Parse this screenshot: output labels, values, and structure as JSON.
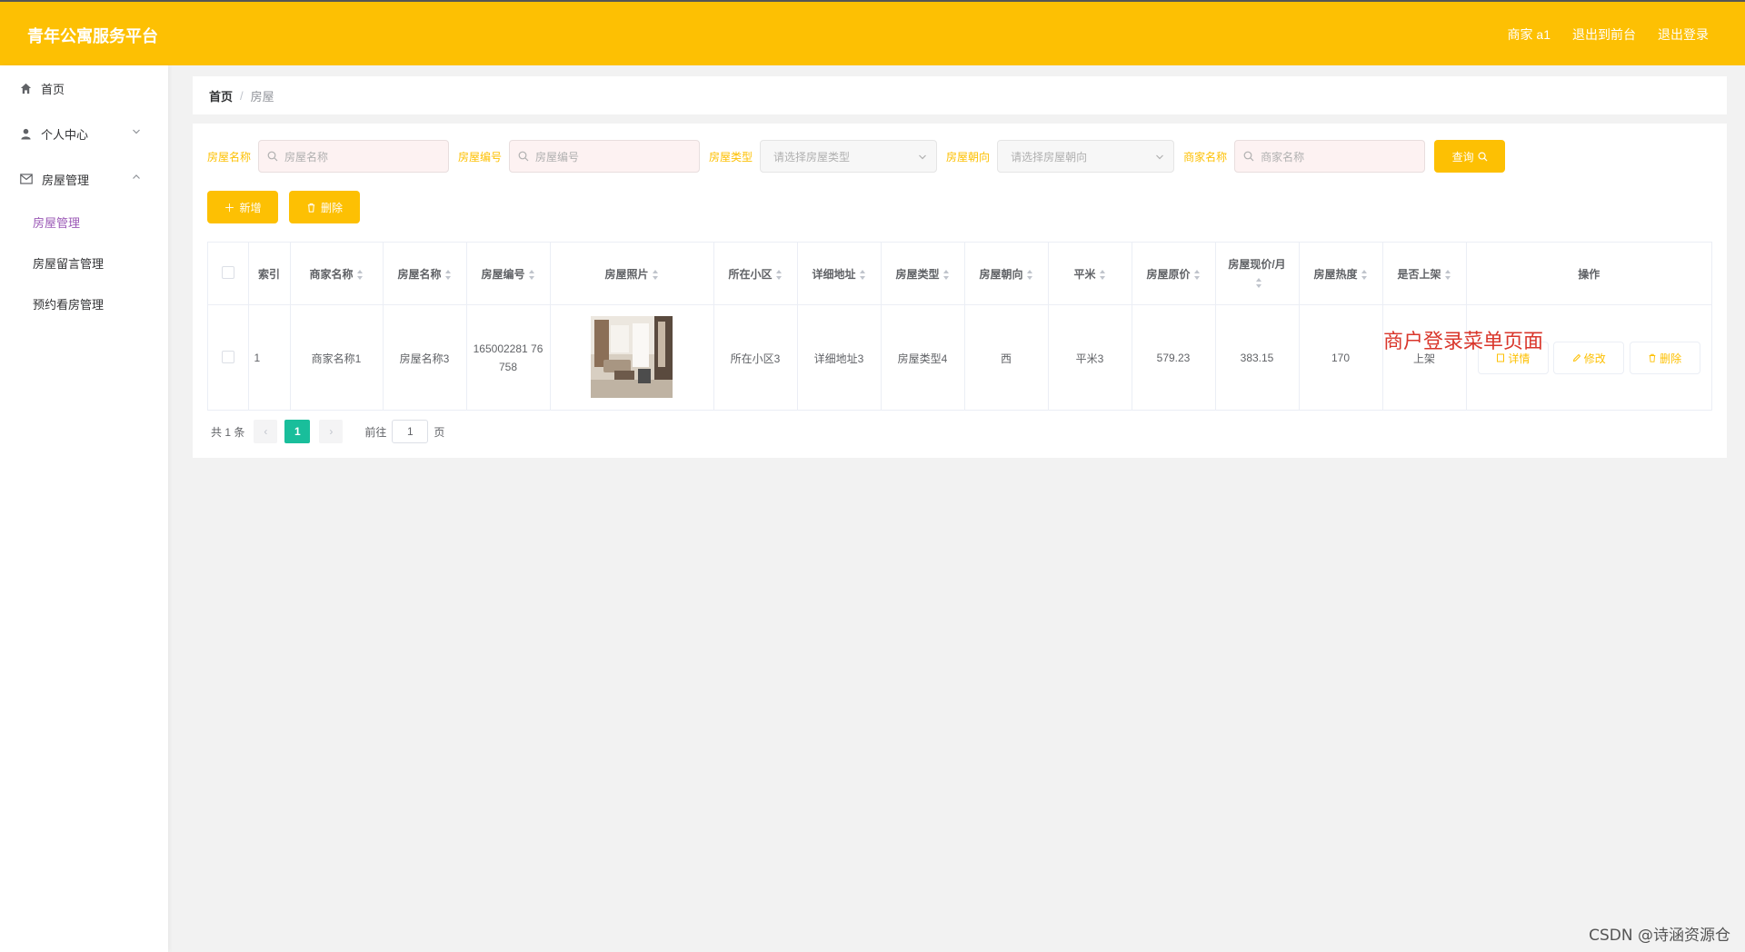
{
  "header": {
    "title": "青年公寓服务平台",
    "user_label": "商家 a1",
    "back_label": "退出到前台",
    "logout_label": "退出登录"
  },
  "sidebar": {
    "items": [
      {
        "label": "首页",
        "icon": "home-icon"
      },
      {
        "label": "个人中心",
        "icon": "user-icon"
      },
      {
        "label": "房屋管理",
        "icon": "mail-icon",
        "expanded": true
      }
    ],
    "submenu": [
      {
        "label": "房屋管理",
        "active": true
      },
      {
        "label": "房屋留言管理"
      },
      {
        "label": "预约看房管理"
      }
    ]
  },
  "breadcrumb": {
    "home": "首页",
    "separator": "/",
    "current": "房屋"
  },
  "search": {
    "name_label": "房屋名称",
    "name_placeholder": "房屋名称",
    "code_label": "房屋编号",
    "code_placeholder": "房屋编号",
    "type_label": "房屋类型",
    "type_placeholder": "请选择房屋类型",
    "direction_label": "房屋朝向",
    "direction_placeholder": "请选择房屋朝向",
    "merchant_label": "商家名称",
    "merchant_placeholder": "商家名称",
    "query_label": "查询"
  },
  "actions": {
    "add_label": "新增",
    "delete_label": "删除"
  },
  "table": {
    "columns": [
      "索引",
      "商家名称",
      "房屋名称",
      "房屋编号",
      "房屋照片",
      "所在小区",
      "详细地址",
      "房屋类型",
      "房屋朝向",
      "平米",
      "房屋原价",
      "房屋现价/月",
      "房屋热度",
      "是否上架",
      "操作"
    ],
    "rows": [
      {
        "index": "1",
        "merchant": "商家名称1",
        "name": "房屋名称3",
        "code": "165002281 76758",
        "community": "所在小区3",
        "address": "详细地址3",
        "type": "房屋类型4",
        "direction": "西",
        "area": "平米3",
        "orig_price": "579.23",
        "price": "383.15",
        "heat": "170",
        "listed": "上架"
      }
    ],
    "ops": {
      "detail": "详情",
      "edit": "修改",
      "delete": "删除"
    }
  },
  "pagination": {
    "total_text": "共 1 条",
    "current_page": "1",
    "goto_label": "前往",
    "goto_value": "1",
    "page_suffix": "页"
  },
  "overlay_note": "商户登录菜单页面",
  "watermark": "CSDN @诗涵资源仓",
  "colors": {
    "accent": "#fdc003",
    "page_active": "#19be9b",
    "note": "#d9362b"
  }
}
